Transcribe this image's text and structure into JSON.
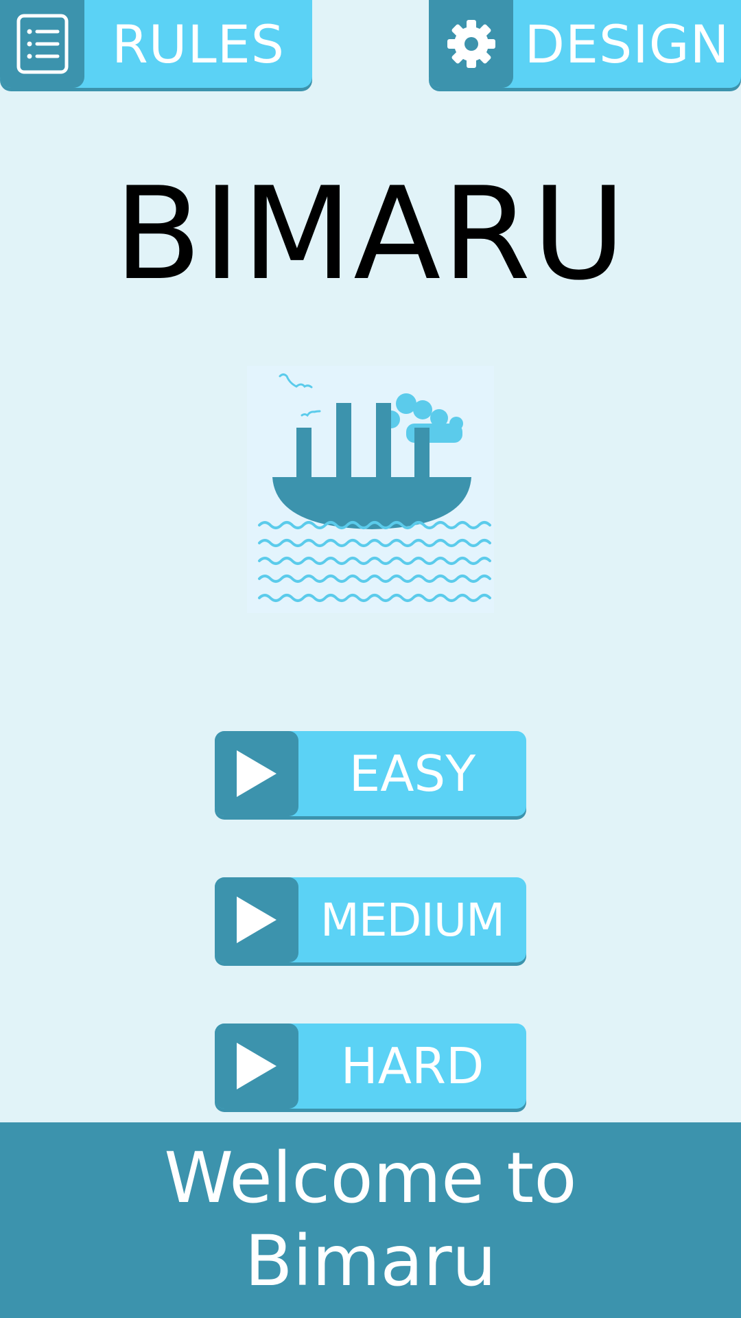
{
  "header": {
    "rules_label": "RULES",
    "design_label": "DESIGN"
  },
  "title": "BIMARU",
  "difficulties": {
    "easy_label": "EASY",
    "medium_label": "MEDIUM",
    "hard_label": "HARD"
  },
  "banner": {
    "line1": "Welcome to",
    "line2": "Bimaru"
  },
  "icons": {
    "rules": "list-icon",
    "design": "gear-icon",
    "play": "play-icon",
    "logo": "ship-logo"
  },
  "colors": {
    "background": "#e1f3f8",
    "button_light": "#5bd2f5",
    "button_dark": "#3c93ad",
    "title": "#000000",
    "banner": "#3c93ad"
  }
}
